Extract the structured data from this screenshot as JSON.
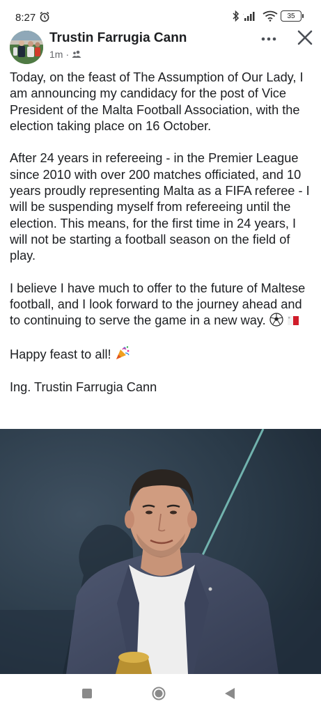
{
  "status_bar": {
    "time": "8:27",
    "battery": "35"
  },
  "post": {
    "author": "Trustin Farrugia Cann",
    "time_ago": "1m",
    "meta_separator": "·",
    "paragraphs": [
      "Today, on the feast of The Assumption of Our Lady, I am announcing my candidacy for the post of Vice President of the Malta Football Association, with the election taking place on 16 October.",
      "After 24 years in refereeing - in the Premier League since 2010 with over 200 matches officiated, and 10 years proudly representing Malta as a FIFA referee - I will be suspending myself from refereeing until the election. This means, for the first time in 24 years, I will not be starting a football season on the field of play.",
      "I believe I have much to offer to the future of Maltese football, and I look forward to the journey ahead and to continuing to serve the game in a new way.",
      "Happy feast to all!",
      "Ing. Trustin Farrugia Cann"
    ],
    "icons": {
      "audience": "friends-icon",
      "emoji_ball": "soccer-ball-icon",
      "emoji_flag": "malta-flag-icon",
      "emoji_party": "party-popper-icon"
    }
  },
  "colors": {
    "text": "#1c1e21",
    "meta": "#65676b",
    "image_bg": "#2b3947"
  }
}
